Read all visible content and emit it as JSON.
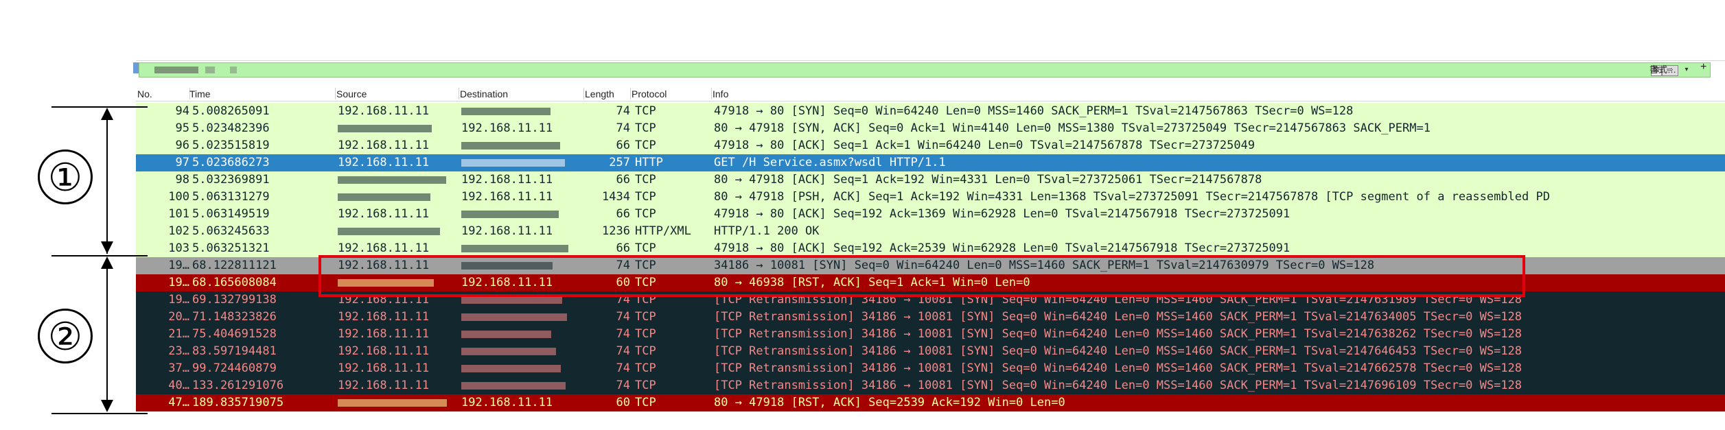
{
  "filter": {
    "clear_glyph": "⊠",
    "apply_glyph": "⇨",
    "dropdown_glyph": "▾",
    "expression_label": "書式…",
    "add_glyph": "+"
  },
  "columns": {
    "no": "No.",
    "time": "Time",
    "source": "Source",
    "destination": "Destination",
    "length": "Length",
    "protocol": "Protocol",
    "info": "Info"
  },
  "annotations": {
    "group1": "①",
    "group2": "②"
  },
  "colors": {
    "tcp_green": "#e4ffc7",
    "selected": "#2a84c6",
    "gray": "#a0a0a0",
    "reset_red": "#a40000",
    "retransmission_dark": "#12272e",
    "highlight_red": "#e2000c"
  },
  "packets": [
    {
      "no": "94",
      "time": "5.008265091",
      "src": "192.168.11.11",
      "dst": "",
      "len": "74",
      "proto": "TCP",
      "info": "47918 → 80 [SYN] Seq=0 Win=64240 Len=0 MSS=1460 SACK_PERM=1 TSval=2147567863 TSecr=0 WS=128",
      "style": "g"
    },
    {
      "no": "95",
      "time": "5.023482396",
      "src": "",
      "dst": "192.168.11.11",
      "len": "74",
      "proto": "TCP",
      "info": "80 → 47918 [SYN, ACK] Seq=0 Ack=1 Win=4140 Len=0 MSS=1380 TSval=273725049 TSecr=2147567863 SACK_PERM=1",
      "style": "g"
    },
    {
      "no": "96",
      "time": "5.023515819",
      "src": "192.168.11.11",
      "dst": "",
      "len": "66",
      "proto": "TCP",
      "info": "47918 → 80 [ACK] Seq=1 Ack=1 Win=64240 Len=0 TSval=2147567878 TSecr=273725049",
      "style": "g"
    },
    {
      "no": "97",
      "time": "5.023686273",
      "src": "192.168.11.11",
      "dst": "",
      "len": "257",
      "proto": "HTTP",
      "info": "GET /H              Service.asmx?wsdl HTTP/1.1",
      "style": "sel"
    },
    {
      "no": "98",
      "time": "5.032369891",
      "src": "",
      "dst": "192.168.11.11",
      "len": "66",
      "proto": "TCP",
      "info": "80 → 47918 [ACK] Seq=1 Ack=192 Win=4331 Len=0 TSval=273725061 TSecr=2147567878",
      "style": "g"
    },
    {
      "no": "100",
      "time": "5.063131279",
      "src": "",
      "dst": "192.168.11.11",
      "len": "1434",
      "proto": "TCP",
      "info": "80 → 47918 [PSH, ACK] Seq=1 Ack=192 Win=4331 Len=1368 TSval=273725091 TSecr=2147567878 [TCP segment of a reassembled PD",
      "style": "g"
    },
    {
      "no": "101",
      "time": "5.063149519",
      "src": "192.168.11.11",
      "dst": "",
      "len": "66",
      "proto": "TCP",
      "info": "47918 → 80 [ACK] Seq=192 Ack=1369 Win=62928 Len=0 TSval=2147567918 TSecr=273725091",
      "style": "g"
    },
    {
      "no": "102",
      "time": "5.063245633",
      "src": "",
      "dst": "192.168.11.11",
      "len": "1236",
      "proto": "HTTP/XML",
      "info": "HTTP/1.1 200 OK",
      "style": "g"
    },
    {
      "no": "103",
      "time": "5.063251321",
      "src": "192.168.11.11",
      "dst": "",
      "len": "66",
      "proto": "TCP",
      "info": "47918 → 80 [ACK] Seq=192 Ack=2539 Win=62928 Len=0 TSval=2147567918 TSecr=273725091",
      "style": "g"
    },
    {
      "no": "19…",
      "time": "68.122811121",
      "src": "192.168.11.11",
      "dst": "",
      "len": "74",
      "proto": "TCP",
      "info": "34186 → 10081 [SYN] Seq=0 Win=64240 Len=0 MSS=1460 SACK_PERM=1 TSval=2147630979 TSecr=0 WS=128",
      "style": "gray"
    },
    {
      "no": "19…",
      "time": "68.165608084",
      "src": "",
      "dst": "192.168.11.11",
      "len": "60",
      "proto": "TCP",
      "info": "80 → 46938 [RST, ACK] Seq=1 Ack=1 Win=0 Len=0",
      "style": "red"
    },
    {
      "no": "19…",
      "time": "69.132799138",
      "src": "192.168.11.11",
      "dst": "",
      "len": "74",
      "proto": "TCP",
      "info": "[TCP Retransmission] 34186 → 10081 [SYN] Seq=0 Win=64240 Len=0 MSS=1460 SACK_PERM=1 TSval=2147631989 TSecr=0 WS=128",
      "style": "dark"
    },
    {
      "no": "20…",
      "time": "71.148323826",
      "src": "192.168.11.11",
      "dst": "",
      "len": "74",
      "proto": "TCP",
      "info": "[TCP Retransmission] 34186 → 10081 [SYN] Seq=0 Win=64240 Len=0 MSS=1460 SACK_PERM=1 TSval=2147634005 TSecr=0 WS=128",
      "style": "dark"
    },
    {
      "no": "21…",
      "time": "75.404691528",
      "src": "192.168.11.11",
      "dst": "",
      "len": "74",
      "proto": "TCP",
      "info": "[TCP Retransmission] 34186 → 10081 [SYN] Seq=0 Win=64240 Len=0 MSS=1460 SACK_PERM=1 TSval=2147638262 TSecr=0 WS=128",
      "style": "dark"
    },
    {
      "no": "23…",
      "time": "83.597194481",
      "src": "192.168.11.11",
      "dst": "",
      "len": "74",
      "proto": "TCP",
      "info": "[TCP Retransmission] 34186 → 10081 [SYN] Seq=0 Win=64240 Len=0 MSS=1460 SACK_PERM=1 TSval=2147646453 TSecr=0 WS=128",
      "style": "dark"
    },
    {
      "no": "37…",
      "time": "99.724460879",
      "src": "192.168.11.11",
      "dst": "",
      "len": "74",
      "proto": "TCP",
      "info": "[TCP Retransmission] 34186 → 10081 [SYN] Seq=0 Win=64240 Len=0 MSS=1460 SACK_PERM=1 TSval=2147662578 TSecr=0 WS=128",
      "style": "dark"
    },
    {
      "no": "40…",
      "time": "133.261291076",
      "src": "192.168.11.11",
      "dst": "",
      "len": "74",
      "proto": "TCP",
      "info": "[TCP Retransmission] 34186 → 10081 [SYN] Seq=0 Win=64240 Len=0 MSS=1460 SACK_PERM=1 TSval=2147696109 TSecr=0 WS=128",
      "style": "dark"
    },
    {
      "no": "47…",
      "time": "189.835719075",
      "src": "",
      "dst": "192.168.11.11",
      "len": "60",
      "proto": "TCP",
      "info": "80 → 47918 [RST, ACK] Seq=2539 Ack=192 Win=0 Len=0",
      "style": "red"
    }
  ]
}
